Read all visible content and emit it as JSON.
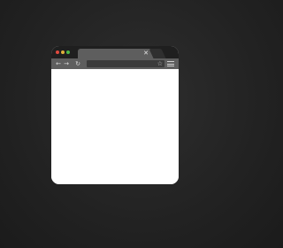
{
  "colors": {
    "background": "#242424",
    "titlebar": "#1f1f1f",
    "tab": "#5e5e5e",
    "toolbar": "#5e5e5e",
    "address_bar": "#3b3b3b",
    "content": "#ffffff",
    "traffic_red": "#e04a3f",
    "traffic_yellow": "#e0b03a",
    "traffic_green": "#4cb848"
  },
  "tab": {
    "label": "",
    "close_icon": "close-icon"
  },
  "toolbar": {
    "back_icon": "arrow-left-icon",
    "forward_icon": "arrow-right-icon",
    "reload_icon": "reload-icon",
    "address_value": "",
    "bookmark_icon": "star-icon",
    "menu_icon": "hamburger-menu-icon"
  }
}
